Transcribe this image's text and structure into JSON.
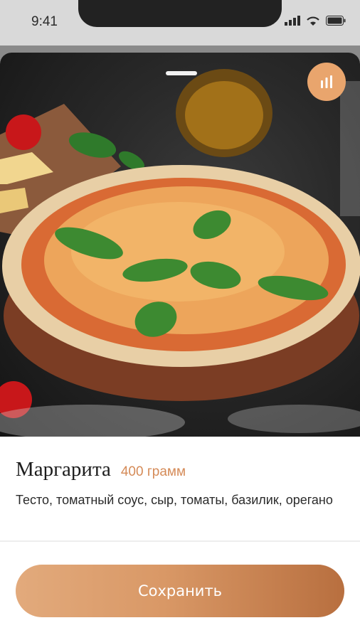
{
  "status_bar": {
    "time": "9:41"
  },
  "icons": {
    "signal": "signal-icon",
    "wifi": "wifi-icon",
    "battery": "battery-icon",
    "stats": "bar-chart-icon"
  },
  "product": {
    "name": "Маргарита",
    "weight": "400 грамм",
    "description": "Тесто, томатный соус, сыр, томаты, базилик, орегано"
  },
  "actions": {
    "save_label": "Сохранить"
  },
  "colors": {
    "accent": "#d99866",
    "accent_dark": "#b86f3f",
    "weight_text": "#d58b58"
  }
}
